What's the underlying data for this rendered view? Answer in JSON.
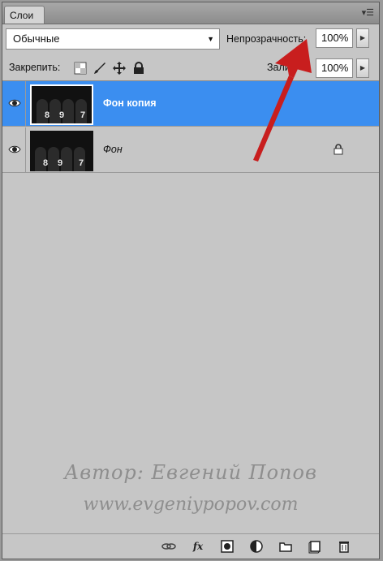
{
  "panel": {
    "tab_label": "Слои",
    "menu_icon": "panel-menu-icon"
  },
  "blend": {
    "value": "Обычные",
    "options": [
      "Обычные"
    ]
  },
  "opacity": {
    "label": "Непрозрачность:",
    "value": "100%"
  },
  "lock": {
    "label": "Закрепить:",
    "icons": [
      "lock-transparent-pixels-icon",
      "lock-image-pixels-icon",
      "lock-position-icon",
      "lock-all-icon"
    ]
  },
  "fill": {
    "label_visible": "Зали",
    "value": "100%"
  },
  "layers": [
    {
      "name": "Фон копия",
      "selected": true,
      "visible": true,
      "locked": false,
      "thumb_numbers": [
        "8",
        "9",
        "7"
      ]
    },
    {
      "name": "Фон",
      "selected": false,
      "visible": true,
      "locked": true,
      "thumb_numbers": [
        "8",
        "9",
        "7"
      ]
    }
  ],
  "watermark": {
    "line1": "Автор: Евгений Попов",
    "line2": "www.evgeniypopov.com"
  },
  "bottom_icons": [
    "link-layers-icon",
    "fx-icon",
    "layer-mask-icon",
    "adjustment-layer-icon",
    "new-group-icon",
    "new-layer-icon",
    "delete-layer-icon"
  ],
  "colors": {
    "selection": "#3b8ef0",
    "panel_bg": "#c6c6c6",
    "annotation_arrow": "#c81e1e"
  }
}
